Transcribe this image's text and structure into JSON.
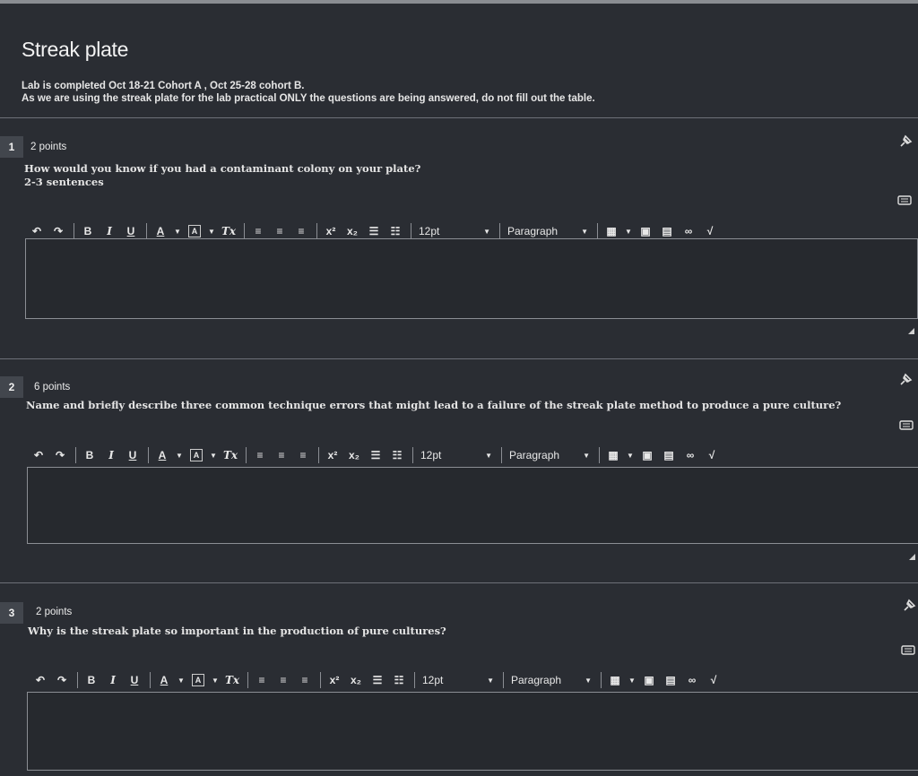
{
  "page": {
    "title": "Streak plate",
    "intro_line1": "Lab is completed Oct 18-21 Cohort A , Oct 25-28 cohort B.",
    "intro_line2": "As we are using the streak plate for the lab practical ONLY the questions are being answered, do not fill out the table."
  },
  "toolbar": {
    "font_size": "12pt",
    "block_format": "Paragraph",
    "bold": "B",
    "italic": "I",
    "underline": "U",
    "font_color": "A",
    "bg_color": "A",
    "clear_format": "Tx",
    "superscript": "x²",
    "subscript": "x₂"
  },
  "questions": [
    {
      "number": "1",
      "points": "2 points",
      "text": "How would you know if you had a contaminant colony on your plate?",
      "subtext": "2-3 sentences",
      "answer": ""
    },
    {
      "number": "2",
      "points": "6 points",
      "text": "Name and briefly describe three common technique errors that might lead to a failure of the streak plate method to produce a pure culture?",
      "answer": ""
    },
    {
      "number": "3",
      "points": "2 points",
      "text": "Why is the streak plate so important in the production of pure cultures?",
      "answer": ""
    }
  ]
}
